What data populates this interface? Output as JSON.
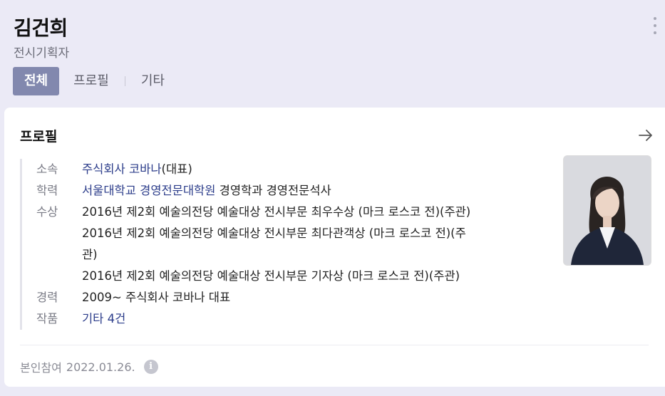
{
  "person": {
    "name": "김건희",
    "job": "전시기획자"
  },
  "tabs": [
    {
      "label": "전체",
      "active": true
    },
    {
      "label": "프로필",
      "active": false
    },
    {
      "label": "기타",
      "active": false
    }
  ],
  "profile": {
    "title": "프로필",
    "affiliation": {
      "label": "소속",
      "link": "주식회사 코바나",
      "suffix": "(대표)"
    },
    "education": {
      "label": "학력",
      "link": "서울대학교 경영전문대학원",
      "suffix": " 경영학과 경영전문석사"
    },
    "awards": {
      "label": "수상",
      "items": [
        "2016년 제2회 예술의전당 예술대상 전시부문 최우수상 (마크 로스코 전)(주관)",
        "2016년 제2회 예술의전당 예술대상 전시부문 최다관객상 (마크 로스코 전)(주",
        "관)",
        "2016년 제2회 예술의전당 예술대상 전시부문 기자상 (마크 로스코 전)(주관)"
      ]
    },
    "career": {
      "label": "경력",
      "value": "2009~ 주식회사 코바나 대표"
    },
    "works": {
      "label": "작품",
      "link": "기타 4건"
    }
  },
  "footer": {
    "participation": "본인참여",
    "date": "2022.01.26.",
    "info_icon": "i"
  },
  "colors": {
    "background": "#ebeaf6",
    "tab_active": "#8288ae",
    "link": "#2b3c8a"
  }
}
